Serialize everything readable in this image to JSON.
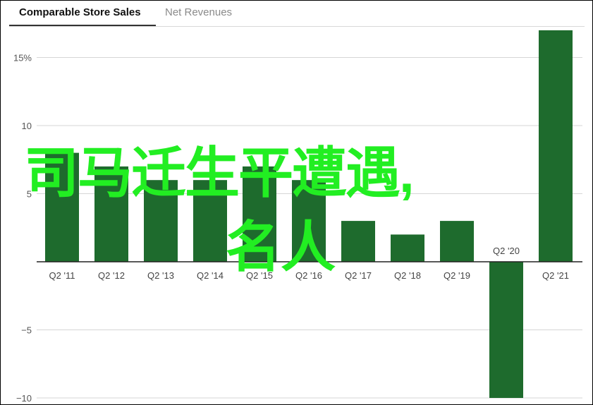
{
  "tabs": [
    {
      "label": "Comparable Store Sales",
      "active": true
    },
    {
      "label": "Net Revenues",
      "active": false
    }
  ],
  "chart_data": {
    "type": "bar",
    "categories": [
      "Q2 '11",
      "Q2 '12",
      "Q2 '13",
      "Q2 '14",
      "Q2 '15",
      "Q2 '16",
      "Q2 '17",
      "Q2 '18",
      "Q2 '19",
      "Q2 '20",
      "Q2 '21"
    ],
    "values": [
      8,
      7,
      6,
      6,
      7,
      6,
      3,
      2,
      3,
      -10,
      17
    ],
    "y_ticks": [
      {
        "value": 15,
        "label": "15%"
      },
      {
        "value": 10,
        "label": "10"
      },
      {
        "value": 5,
        "label": "5"
      },
      {
        "value": -5,
        "label": "−5"
      },
      {
        "value": -10,
        "label": "−10"
      }
    ],
    "ylim": [
      -10,
      17
    ],
    "grid": true,
    "bar_color": "#1e6b2d"
  },
  "overlay": {
    "line1": "司马迁生平遭遇,",
    "line2": "名人"
  }
}
